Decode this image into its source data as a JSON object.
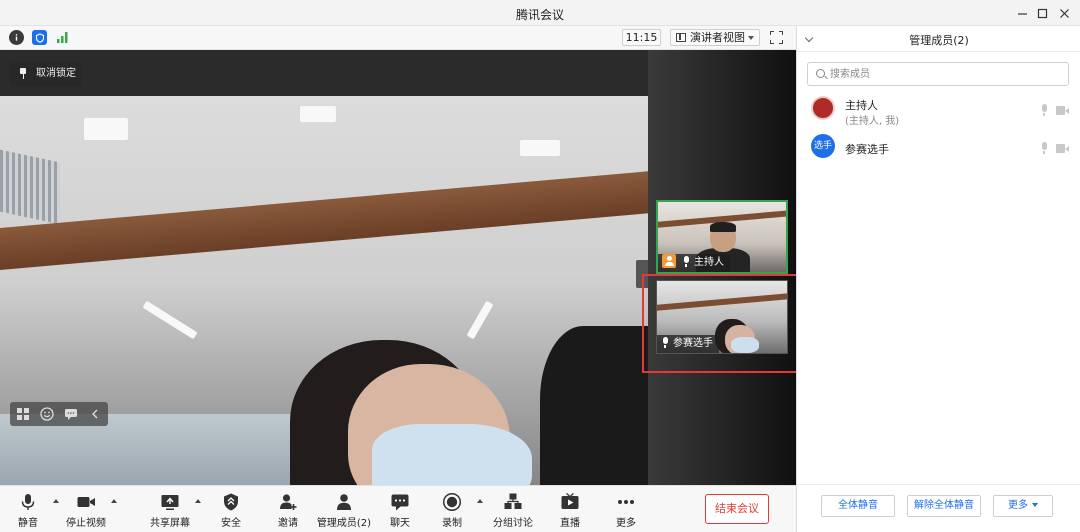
{
  "window": {
    "title": "腾讯会议"
  },
  "topbar": {
    "time": "11:15",
    "view_mode": "演讲者视图"
  },
  "stage": {
    "unlock_label": "取消锁定",
    "thumbnails": [
      {
        "name": "主持人",
        "role": "host"
      },
      {
        "name": "参赛选手",
        "role": "guest"
      }
    ]
  },
  "controls": {
    "mute": "静音",
    "stop_video": "停止视频",
    "share_screen": "共享屏幕",
    "security": "安全",
    "invite": "邀请",
    "manage_members": "管理成员(2)",
    "chat": "聊天",
    "record": "录制",
    "breakout": "分组讨论",
    "live": "直播",
    "more": "更多",
    "end_meeting": "结束会议"
  },
  "panel": {
    "title": "管理成员(2)",
    "search_placeholder": "搜索成员",
    "members": [
      {
        "name": "主持人",
        "sub": "(主持人, 我)",
        "avatar_text": ""
      },
      {
        "name": "参赛选手",
        "sub": "",
        "avatar_text": "选手"
      }
    ],
    "footer": {
      "mute_all": "全体静音",
      "unmute_all": "解除全体静音",
      "more": "更多"
    }
  },
  "colors": {
    "accent": "#1e6fe8",
    "danger": "#e53935",
    "active_border": "#33a552",
    "host_badge": "#f29a38"
  }
}
